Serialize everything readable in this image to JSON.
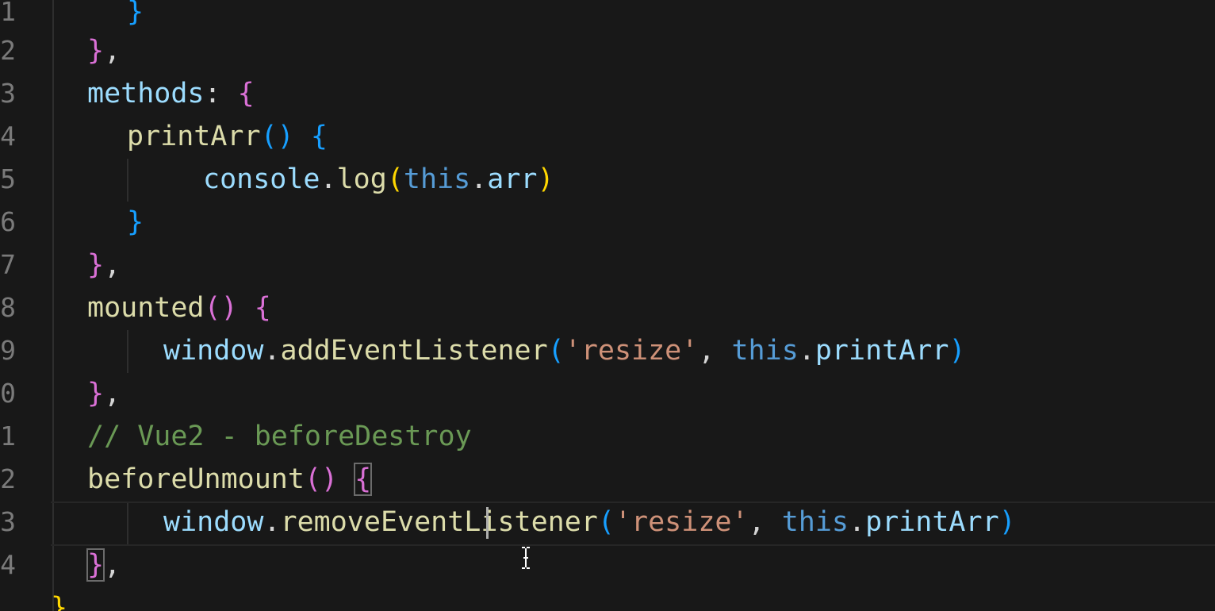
{
  "editor": {
    "language": "javascript",
    "line_numbers": [
      "1",
      "2",
      "3",
      "4",
      "5",
      "6",
      "7",
      "8",
      "9",
      "0",
      "1",
      "2",
      "3",
      "4"
    ],
    "lines": [
      {
        "tokens": [
          {
            "t": "}",
            "c": "b-blue"
          }
        ]
      },
      {
        "tokens": [
          {
            "t": "}",
            "c": "b-magenta"
          },
          {
            "t": ",",
            "c": "plain"
          }
        ]
      },
      {
        "tokens": [
          {
            "t": "methods",
            "c": "prop"
          },
          {
            "t": ": ",
            "c": "plain"
          },
          {
            "t": "{",
            "c": "b-magenta"
          }
        ]
      },
      {
        "tokens": [
          {
            "t": "printArr",
            "c": "fn"
          },
          {
            "t": "()",
            "c": "b-blue"
          },
          {
            "t": " ",
            "c": "plain"
          },
          {
            "t": "{",
            "c": "b-blue"
          }
        ]
      },
      {
        "tokens": [
          {
            "t": "console",
            "c": "prop"
          },
          {
            "t": ".",
            "c": "plain"
          },
          {
            "t": "log",
            "c": "fn"
          },
          {
            "t": "(",
            "c": "b-yellow"
          },
          {
            "t": "this",
            "c": "kw-this"
          },
          {
            "t": ".",
            "c": "plain"
          },
          {
            "t": "arr",
            "c": "prop"
          },
          {
            "t": ")",
            "c": "b-yellow"
          }
        ]
      },
      {
        "tokens": [
          {
            "t": "}",
            "c": "b-blue"
          }
        ]
      },
      {
        "tokens": [
          {
            "t": "}",
            "c": "b-magenta"
          },
          {
            "t": ",",
            "c": "plain"
          }
        ]
      },
      {
        "tokens": [
          {
            "t": "mounted",
            "c": "fn"
          },
          {
            "t": "()",
            "c": "b-magenta"
          },
          {
            "t": " ",
            "c": "plain"
          },
          {
            "t": "{",
            "c": "b-magenta"
          }
        ]
      },
      {
        "tokens": [
          {
            "t": "window",
            "c": "prop"
          },
          {
            "t": ".",
            "c": "plain"
          },
          {
            "t": "addEventListener",
            "c": "fn"
          },
          {
            "t": "(",
            "c": "b-blue"
          },
          {
            "t": "'resize'",
            "c": "str"
          },
          {
            "t": ", ",
            "c": "plain"
          },
          {
            "t": "this",
            "c": "kw-this"
          },
          {
            "t": ".",
            "c": "plain"
          },
          {
            "t": "printArr",
            "c": "prop"
          },
          {
            "t": ")",
            "c": "b-blue"
          }
        ]
      },
      {
        "tokens": [
          {
            "t": "}",
            "c": "b-magenta"
          },
          {
            "t": ",",
            "c": "plain"
          }
        ]
      },
      {
        "tokens": [
          {
            "t": "// Vue2 - beforeDestroy",
            "c": "comment"
          }
        ]
      },
      {
        "tokens": [
          {
            "t": "beforeUnmount",
            "c": "fn"
          },
          {
            "t": "()",
            "c": "b-magenta"
          },
          {
            "t": " ",
            "c": "plain"
          },
          {
            "t": "{",
            "c": "b-magenta"
          }
        ]
      },
      {
        "tokens": [
          {
            "t": "window",
            "c": "prop"
          },
          {
            "t": ".",
            "c": "plain"
          },
          {
            "t": "removeEventListener",
            "c": "fn"
          },
          {
            "t": "(",
            "c": "b-blue"
          },
          {
            "t": "'resize'",
            "c": "str"
          },
          {
            "t": ", ",
            "c": "plain"
          },
          {
            "t": "this",
            "c": "kw-this"
          },
          {
            "t": ".",
            "c": "plain"
          },
          {
            "t": "printArr",
            "c": "prop"
          },
          {
            "t": ")",
            "c": "b-blue"
          }
        ]
      },
      {
        "tokens": [
          {
            "t": "}",
            "c": "b-magenta"
          },
          {
            "t": ",",
            "c": "plain"
          }
        ]
      },
      {
        "tokens": [
          {
            "t": "}",
            "c": "b-yellow"
          }
        ]
      }
    ]
  },
  "icons": {
    "text_cursor": "ibeam-cursor-icon"
  },
  "colors": {
    "background": "#181818",
    "line_number": "#7a7a7a",
    "keyword_this": "#569cd6",
    "function": "#dcdcaa",
    "property": "#9cdcfe",
    "string": "#ce9178",
    "comment": "#6a9955",
    "bracket_magenta": "#da70d6",
    "bracket_blue": "#179fff",
    "bracket_yellow": "#ffd700"
  }
}
